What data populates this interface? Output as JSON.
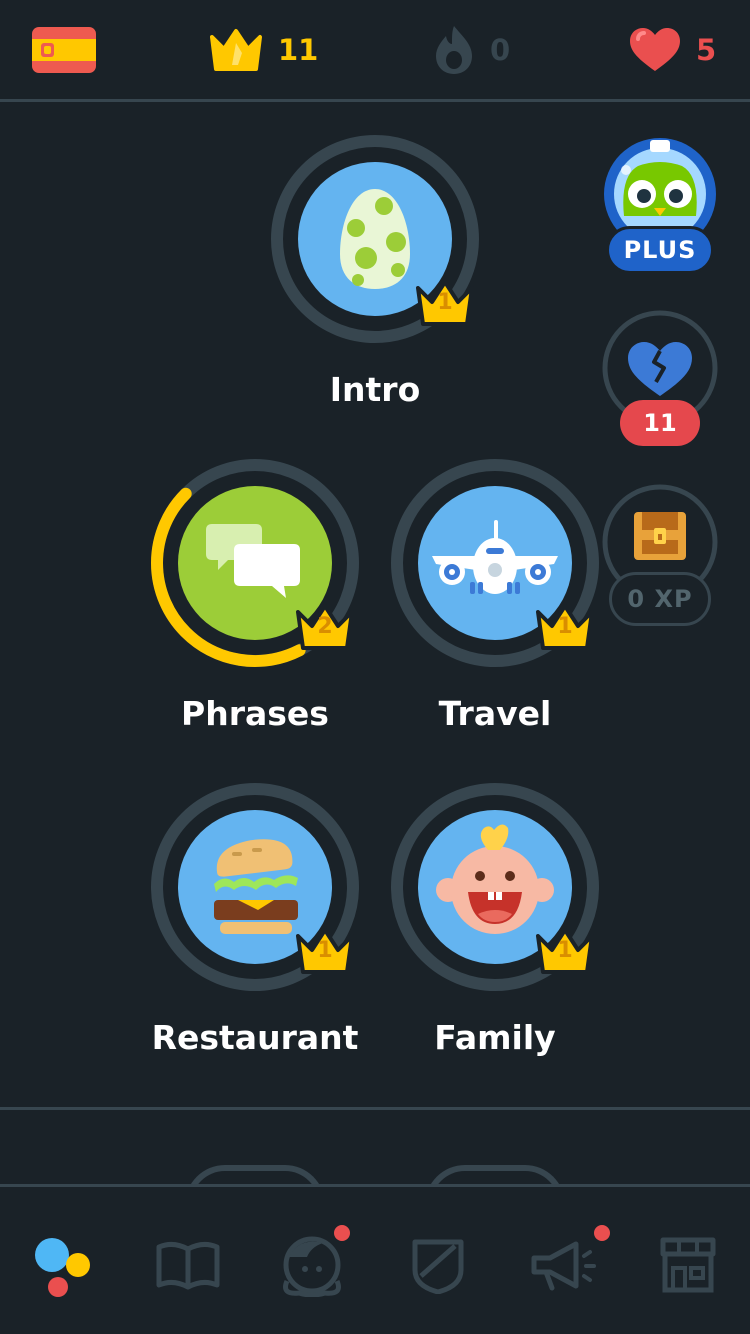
{
  "topbar": {
    "course_flag": "spain-flag",
    "crowns": "11",
    "streak": "0",
    "hearts": "5"
  },
  "skills": [
    {
      "name": "Intro",
      "icon": "egg-icon",
      "crown_level": "1",
      "progress": 0
    },
    {
      "name": "Phrases",
      "icon": "speech-bubbles-icon",
      "crown_level": "2",
      "progress": 0.45
    },
    {
      "name": "Travel",
      "icon": "airplane-icon",
      "crown_level": "1",
      "progress": 0
    },
    {
      "name": "Restaurant",
      "icon": "burger-icon",
      "crown_level": "1",
      "progress": 0
    },
    {
      "name": "Family",
      "icon": "baby-icon",
      "crown_level": "1",
      "progress": 0
    }
  ],
  "side": {
    "plus_label": "PLUS",
    "heal_count": "11",
    "xp_label": "0 XP"
  },
  "nav": [
    "learn-icon",
    "stories-icon",
    "profile-icon",
    "leagues-icon",
    "news-icon",
    "shop-icon"
  ],
  "colors": {
    "background": "#1a2228",
    "ring_track": "#37464f",
    "gold": "#ffc800",
    "blue_skill": "#64b4f0",
    "green_skill": "#9ccd38",
    "heart_red": "#ea4f4f"
  }
}
